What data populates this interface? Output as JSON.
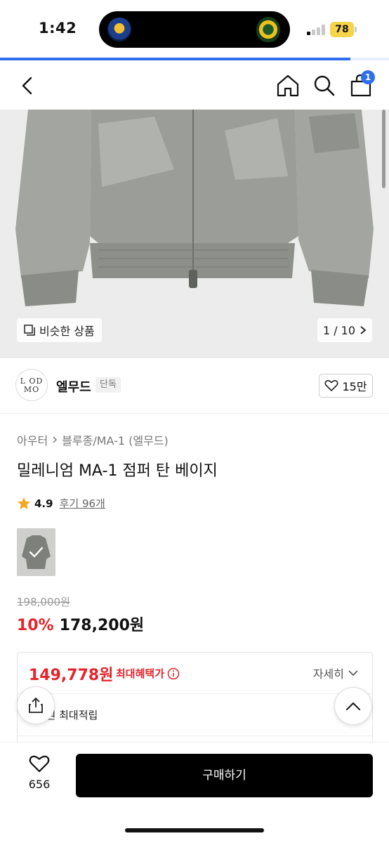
{
  "status_bar": {
    "time": "1:42",
    "battery": "78",
    "battery_color": "#f6d44a"
  },
  "page_progress": 0.9,
  "nav": {
    "cart_count": "1"
  },
  "gallery": {
    "similar_label": "비슷한 상품",
    "counter": "1 / 10"
  },
  "brand": {
    "logo_text": "LMOOD",
    "name": "엘무드",
    "tag": "단독",
    "likes": "15만"
  },
  "product": {
    "breadcrumb": [
      "아우터",
      "블루종/MA-1 (엘무드)"
    ],
    "title": "밀레니엄 MA-1 점퍼 탄 베이지",
    "rating": "4.9",
    "reviews": "후기 96개",
    "original_price": "198,000원",
    "discount": "10%",
    "sale_price": "178,200원"
  },
  "benefit": {
    "best_price": "149,778원",
    "best_label": "최대혜택가",
    "detail_label": "자세히",
    "points": "…2원 최대적립"
  },
  "bottom_bar": {
    "wish_count": "656",
    "buy_label": "구매하기"
  },
  "colors": {
    "accent": "#2f6fec",
    "sale": "#e4242a",
    "star": "#f5a623",
    "buy_button": "#000000"
  }
}
